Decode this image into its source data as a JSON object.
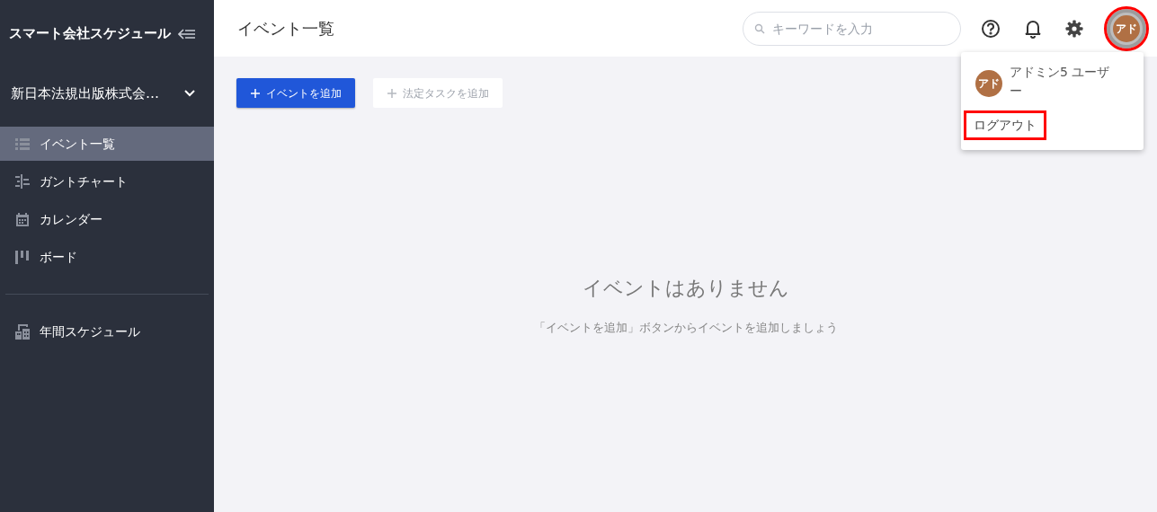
{
  "sidebar": {
    "app_title": "スマート会社スケジュール",
    "company": "新日本法規出版株式会…",
    "items": [
      {
        "label": "イベント一覧",
        "kind": "list",
        "selected": true
      },
      {
        "label": "ガントチャート",
        "kind": "gantt",
        "selected": false
      },
      {
        "label": "カレンダー",
        "kind": "calendar",
        "selected": false
      },
      {
        "label": "ボード",
        "kind": "board",
        "selected": false
      }
    ],
    "extra_items": [
      {
        "label": "年間スケジュール",
        "kind": "building",
        "selected": false
      }
    ]
  },
  "header": {
    "title": "イベント一覧",
    "search": {
      "placeholder": "キーワードを入力"
    },
    "avatar": {
      "initials": "アド",
      "highlighted": true
    }
  },
  "toolbar": [
    {
      "label": "イベントを追加",
      "disabled": false
    },
    {
      "label": "法定タスクを追加",
      "disabled": true
    }
  ],
  "empty_state": {
    "title": "イベントはありません",
    "hint": "「イベントを追加」ボタンからイベントを追加しましょう"
  },
  "user_menu": {
    "initials": "アド",
    "user_name": "アドミン5 ユーザー",
    "items": [
      {
        "label": "ログアウト",
        "highlighted": true
      }
    ]
  }
}
